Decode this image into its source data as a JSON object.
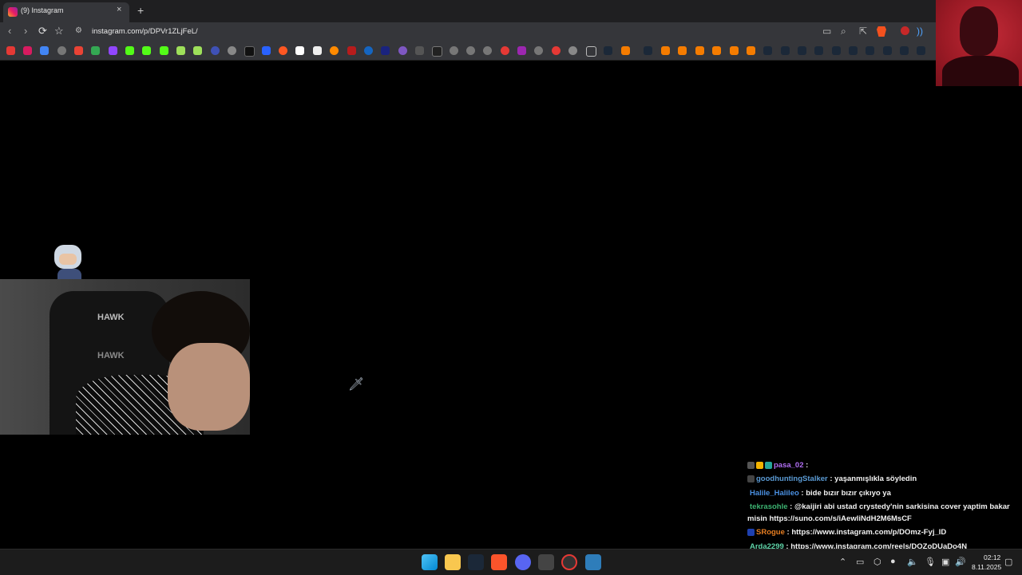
{
  "tab": {
    "title": "(9) Instagram",
    "close": "×",
    "new": "+"
  },
  "toolbar": {
    "back": "‹",
    "forward": "›",
    "reload": "⟳",
    "bookmark": "☆",
    "url": "instagram.com/p/DPVr1ZLjFeL/"
  },
  "webcam_overlay": {
    "logo_top": "HAWK",
    "logo_bottom": "HAWK"
  },
  "chat": {
    "messages": [
      {
        "user": "pasa_02",
        "sep": " :",
        "text": "",
        "color": "#b06ef3"
      },
      {
        "user": "goodhuntingStalker",
        "sep": " : ",
        "text": "yaşanmışlıkla söyledin",
        "color": "#5b9bd5"
      },
      {
        "user": "Halile_Halileo",
        "sep": " : ",
        "text": "bide bızır bızır çıkıyo ya",
        "color": "#4a90e2"
      },
      {
        "user": "tekrasohle",
        "sep": " : ",
        "text": "@kaijiri abi ustad crystedy'nin sarkisina cover yaptim bakar",
        "color": "#3cb371"
      },
      {
        "user": "",
        "sep": "",
        "text": "misin https://suno.com/s/iAewliNdH2M6MsCF",
        "color": "#f2f2f2"
      },
      {
        "user": "SRogue",
        "sep": " : ",
        "text": "https://www.instagram.com/p/DOmz-Fyj_ID",
        "color": "#e67e22"
      },
      {
        "user": "Arda2299",
        "sep": " : ",
        "text": "https://www.instagram.com/reels/DOZoDUaDo4N",
        "color": "#5fd3a8"
      }
    ]
  },
  "taskbar": {
    "time": "02:12",
    "date": "8.11.2025"
  }
}
